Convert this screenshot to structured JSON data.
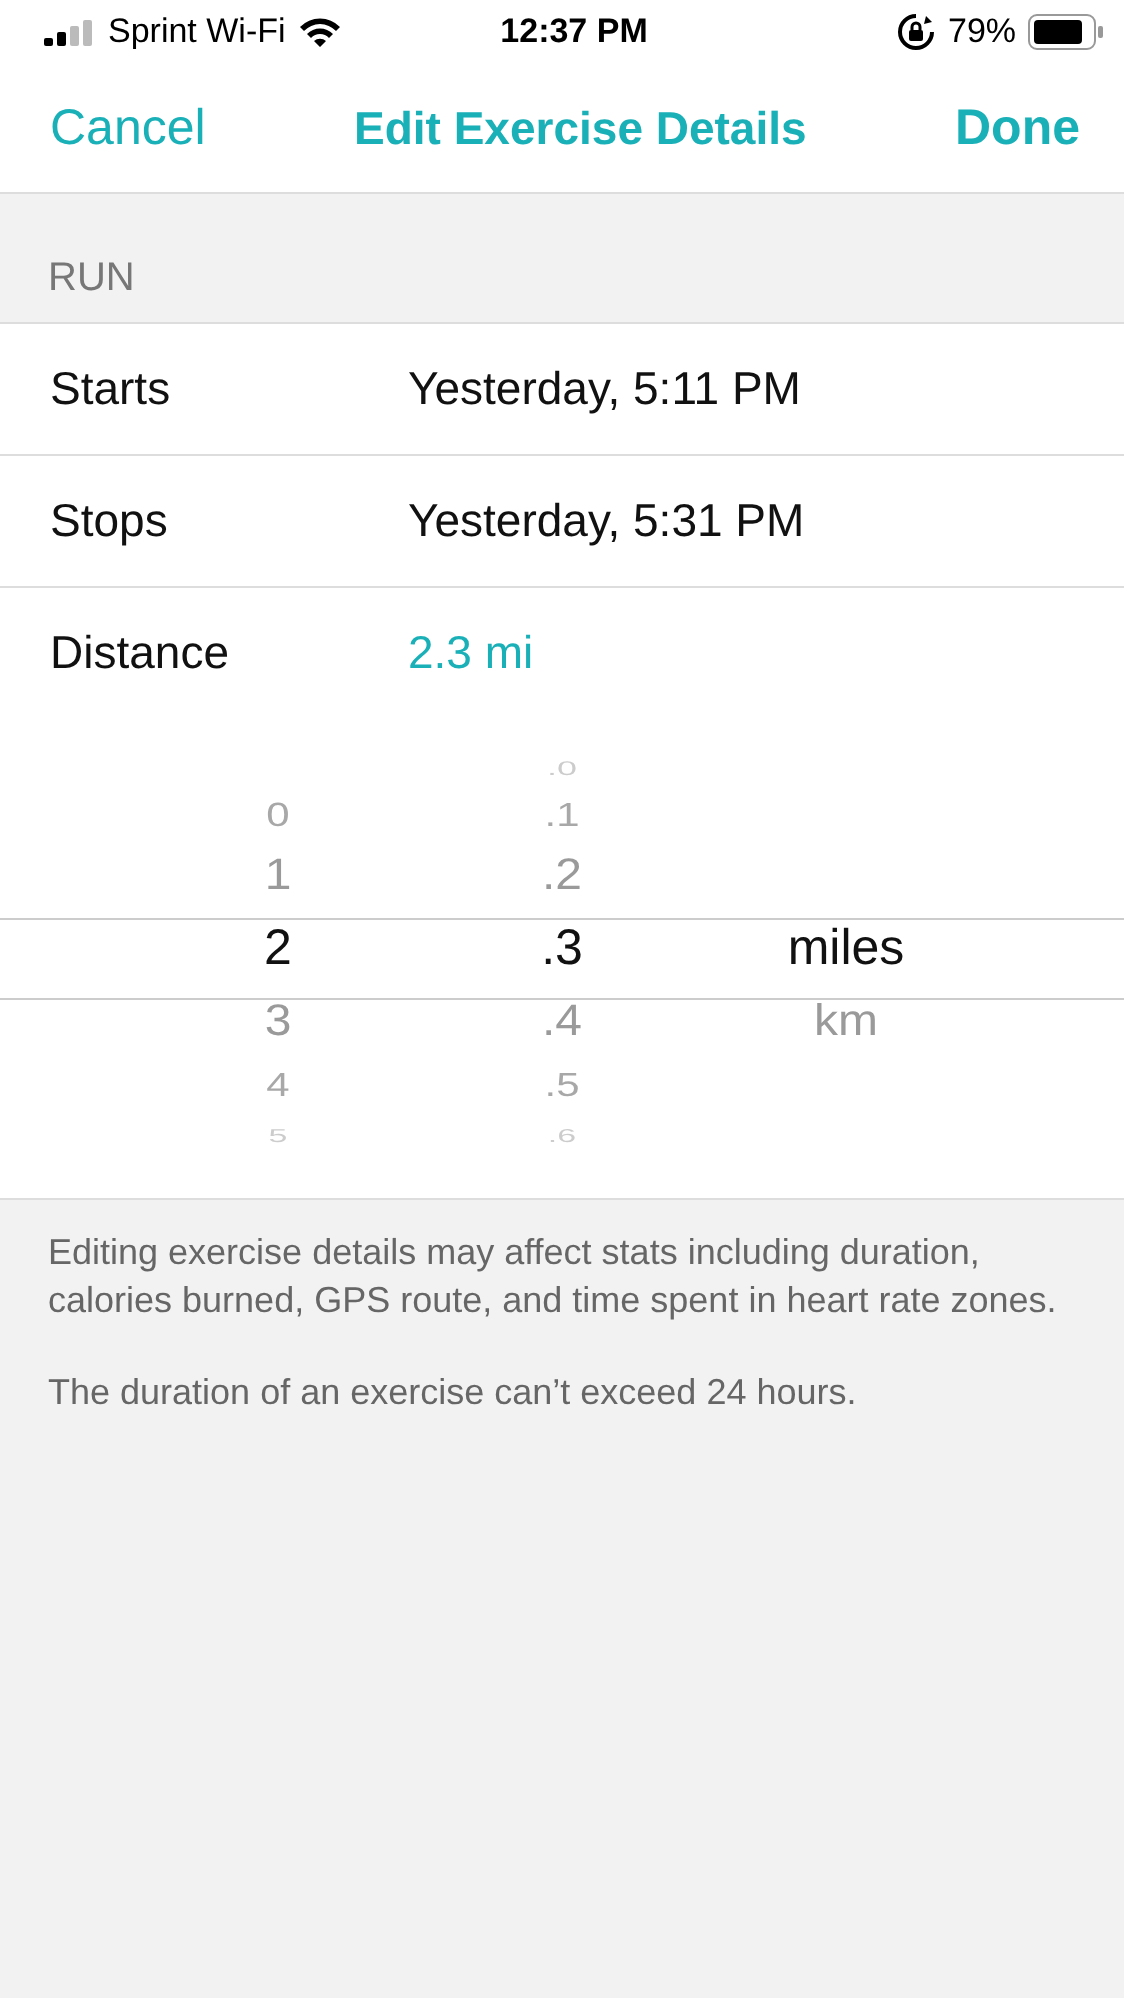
{
  "status_bar": {
    "carrier": "Sprint Wi-Fi",
    "time": "12:37 PM",
    "battery": "79%"
  },
  "nav": {
    "cancel": "Cancel",
    "title": "Edit Exercise Details",
    "done": "Done"
  },
  "section_header": "RUN",
  "rows": [
    {
      "label": "Starts",
      "value": "Yesterday, 5:11 PM",
      "kind": "plain"
    },
    {
      "label": "Stops",
      "value": "Yesterday, 5:31 PM",
      "kind": "plain"
    },
    {
      "label": "Distance",
      "value": "2.3 mi",
      "kind": "accent"
    }
  ],
  "picker": {
    "columns": [
      {
        "items": [
          {
            "label": "0",
            "selected": false
          },
          {
            "label": "1",
            "selected": false
          },
          {
            "label": "2",
            "selected": true
          },
          {
            "label": "3",
            "selected": false
          },
          {
            "label": "4",
            "selected": false
          },
          {
            "label": "5",
            "selected": false
          }
        ]
      },
      {
        "items": [
          {
            "label": ".0",
            "selected": false
          },
          {
            "label": ".1",
            "selected": false
          },
          {
            "label": ".2",
            "selected": false
          },
          {
            "label": ".3",
            "selected": true
          },
          {
            "label": ".4",
            "selected": false
          },
          {
            "label": ".5",
            "selected": false
          },
          {
            "label": ".6",
            "selected": false
          }
        ]
      },
      {
        "items": [
          {
            "label": "miles",
            "selected": true
          },
          {
            "label": "km",
            "selected": false
          }
        ]
      }
    ]
  },
  "notes": [
    "Editing exercise details may affect stats including duration, calories burned, GPS route, and time spent in heart rate zones.",
    "The duration of an exercise can’t exceed 24 hours."
  ]
}
